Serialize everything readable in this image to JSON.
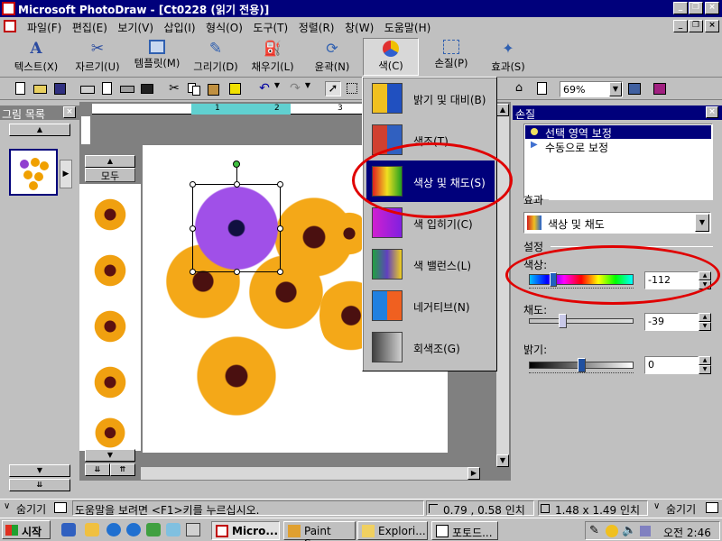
{
  "titlebar": {
    "title": "Microsoft PhotoDraw - [Ct0228 (읽기 전용)]"
  },
  "menubar": {
    "items": [
      "파일(F)",
      "편집(E)",
      "보기(V)",
      "삽입(I)",
      "형식(O)",
      "도구(T)",
      "정렬(R)",
      "창(W)",
      "도움말(H)"
    ]
  },
  "bigbar": {
    "buttons": [
      "텍스트(X)",
      "자르기(U)",
      "템플릿(M)",
      "그리기(D)",
      "채우기(L)",
      "윤곽(N)",
      "색(C)",
      "손질(P)",
      "효과(S)"
    ]
  },
  "stdbar": {
    "zoom": "69%"
  },
  "leftpanel": {
    "title": "그림 목록",
    "palette_label": "모두"
  },
  "ruler": {
    "marks": [
      "1",
      "2",
      "3"
    ]
  },
  "colormenu": {
    "items": [
      "밝기 및 대비(B)",
      "색조(T)",
      "색상 및 채도(S)",
      "색 입히기(C)",
      "색 밸런스(L)",
      "네거티브(N)",
      "회색조(G)"
    ]
  },
  "rightpanel": {
    "title": "손질",
    "modes": [
      "선택 영역 보정",
      "수동으로 보정"
    ],
    "effect_label": "효과",
    "effect_value": "색상 및 채도",
    "settings_label": "설정",
    "hue_label": "색상:",
    "hue_value": "-112",
    "sat_label": "채도:",
    "sat_value": "-39",
    "bright_label": "밝기:",
    "bright_value": "0",
    "hide_label": "숨기기"
  },
  "statusbar": {
    "hide_label": "숨기기",
    "help": "도움말을 보려면 <F1>키를 누르십시오.",
    "position": "0.79 , 0.58 인치",
    "size": "1.48 x 1.49 인치",
    "hide_label2": "숨기기"
  },
  "taskbar": {
    "start": "시작",
    "tasks": [
      "Micro...",
      "Paint S...",
      "Explori...",
      "포토드..."
    ],
    "clock": "오전 2:46"
  },
  "colors": {
    "title_bg": "#00007b",
    "accent": "#e00000",
    "highlight": "#00007b"
  }
}
